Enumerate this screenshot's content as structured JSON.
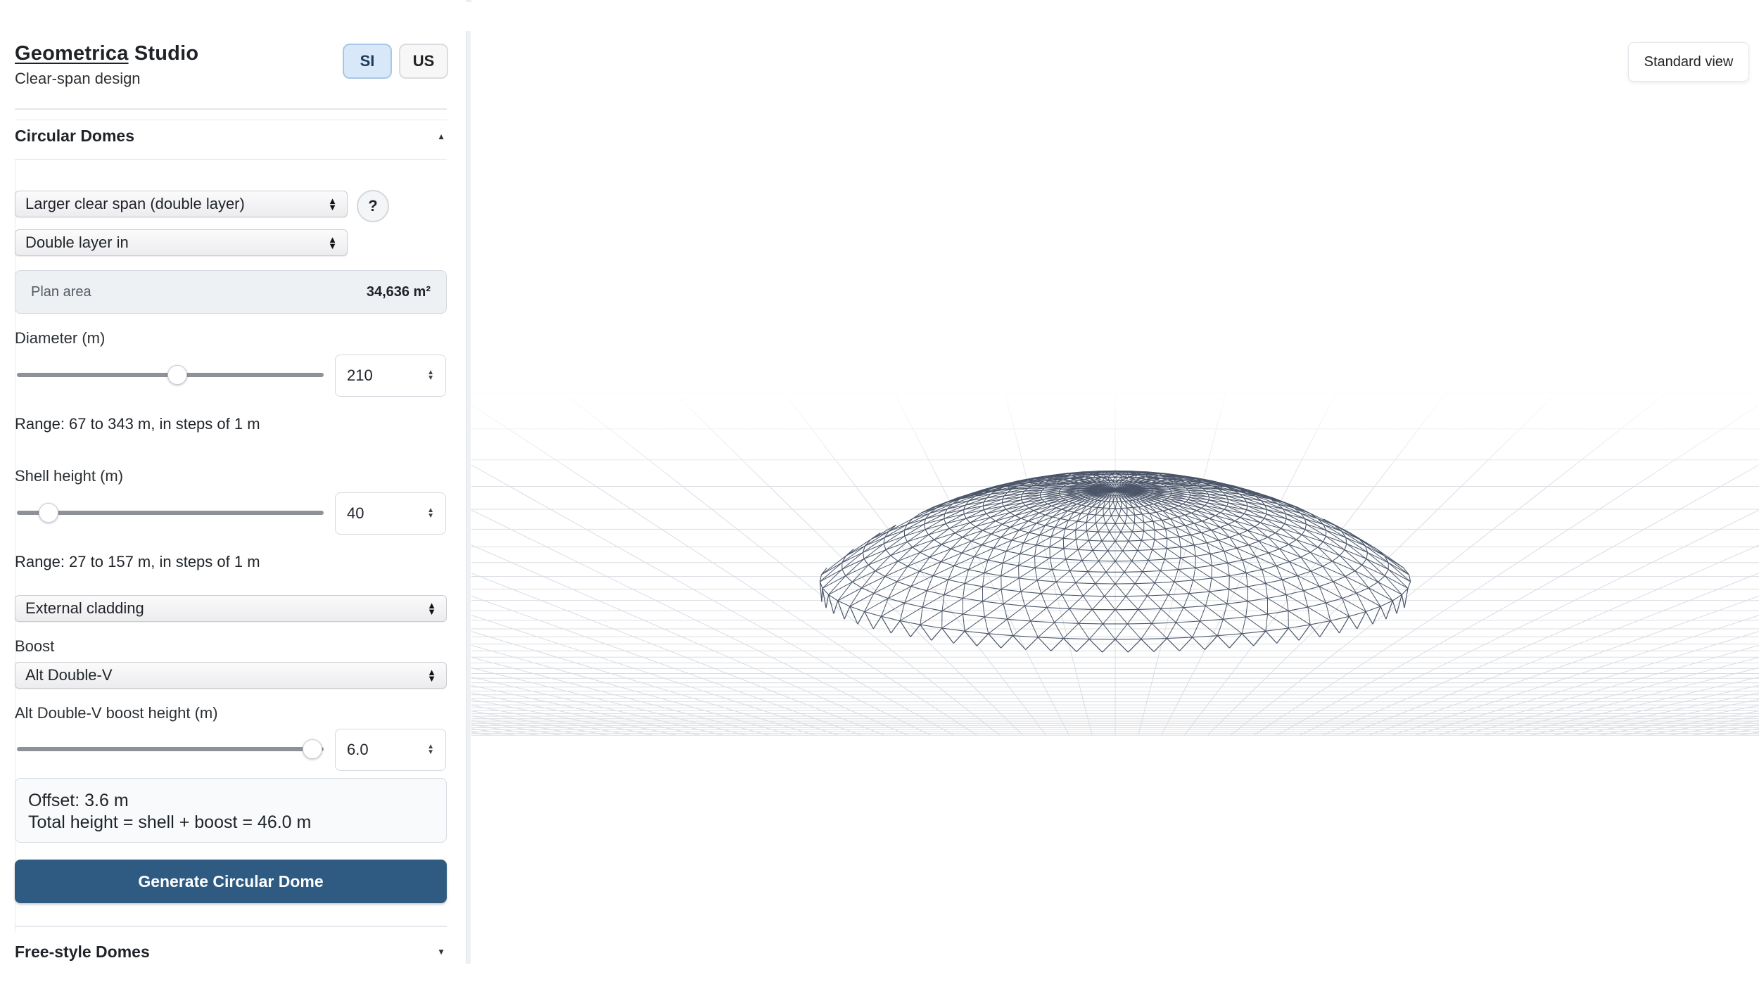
{
  "brand": {
    "name_underlined": "Geometrica",
    "name_rest": " Studio",
    "subtitle": "Clear-span design"
  },
  "units": {
    "si": "SI",
    "us": "US",
    "active": "SI"
  },
  "sections": {
    "circular": "Circular Domes",
    "freestyle": "Free-style Domes"
  },
  "form": {
    "structure_type": "Larger clear span (double layer)",
    "layer_mode": "Double layer in",
    "help": "?",
    "plan_area_label": "Plan area",
    "plan_area_value": "34,636 m²",
    "diameter": {
      "label": "Diameter (m)",
      "value": "210",
      "fraction": 0.52,
      "range": "Range: 67 to 343 m, in steps of 1 m"
    },
    "shell_height": {
      "label": "Shell height (m)",
      "value": "40",
      "fraction": 0.1,
      "range": "Range: 27 to 157 m, in steps of 1 m"
    },
    "cladding": "External cladding",
    "boost_label": "Boost",
    "boost": "Alt Double-V",
    "boost_height": {
      "label": "Alt Double-V boost height (m)",
      "value": "6.0",
      "fraction": 0.96
    },
    "offset": "Offset: 3.6 m",
    "total_height": "Total height = shell + boost = 46.0 m",
    "generate": "Generate Circular Dome"
  },
  "viewport": {
    "standard_view": "Standard view",
    "wire_color": "#4a5568",
    "grid_color": "#d9dde2"
  }
}
